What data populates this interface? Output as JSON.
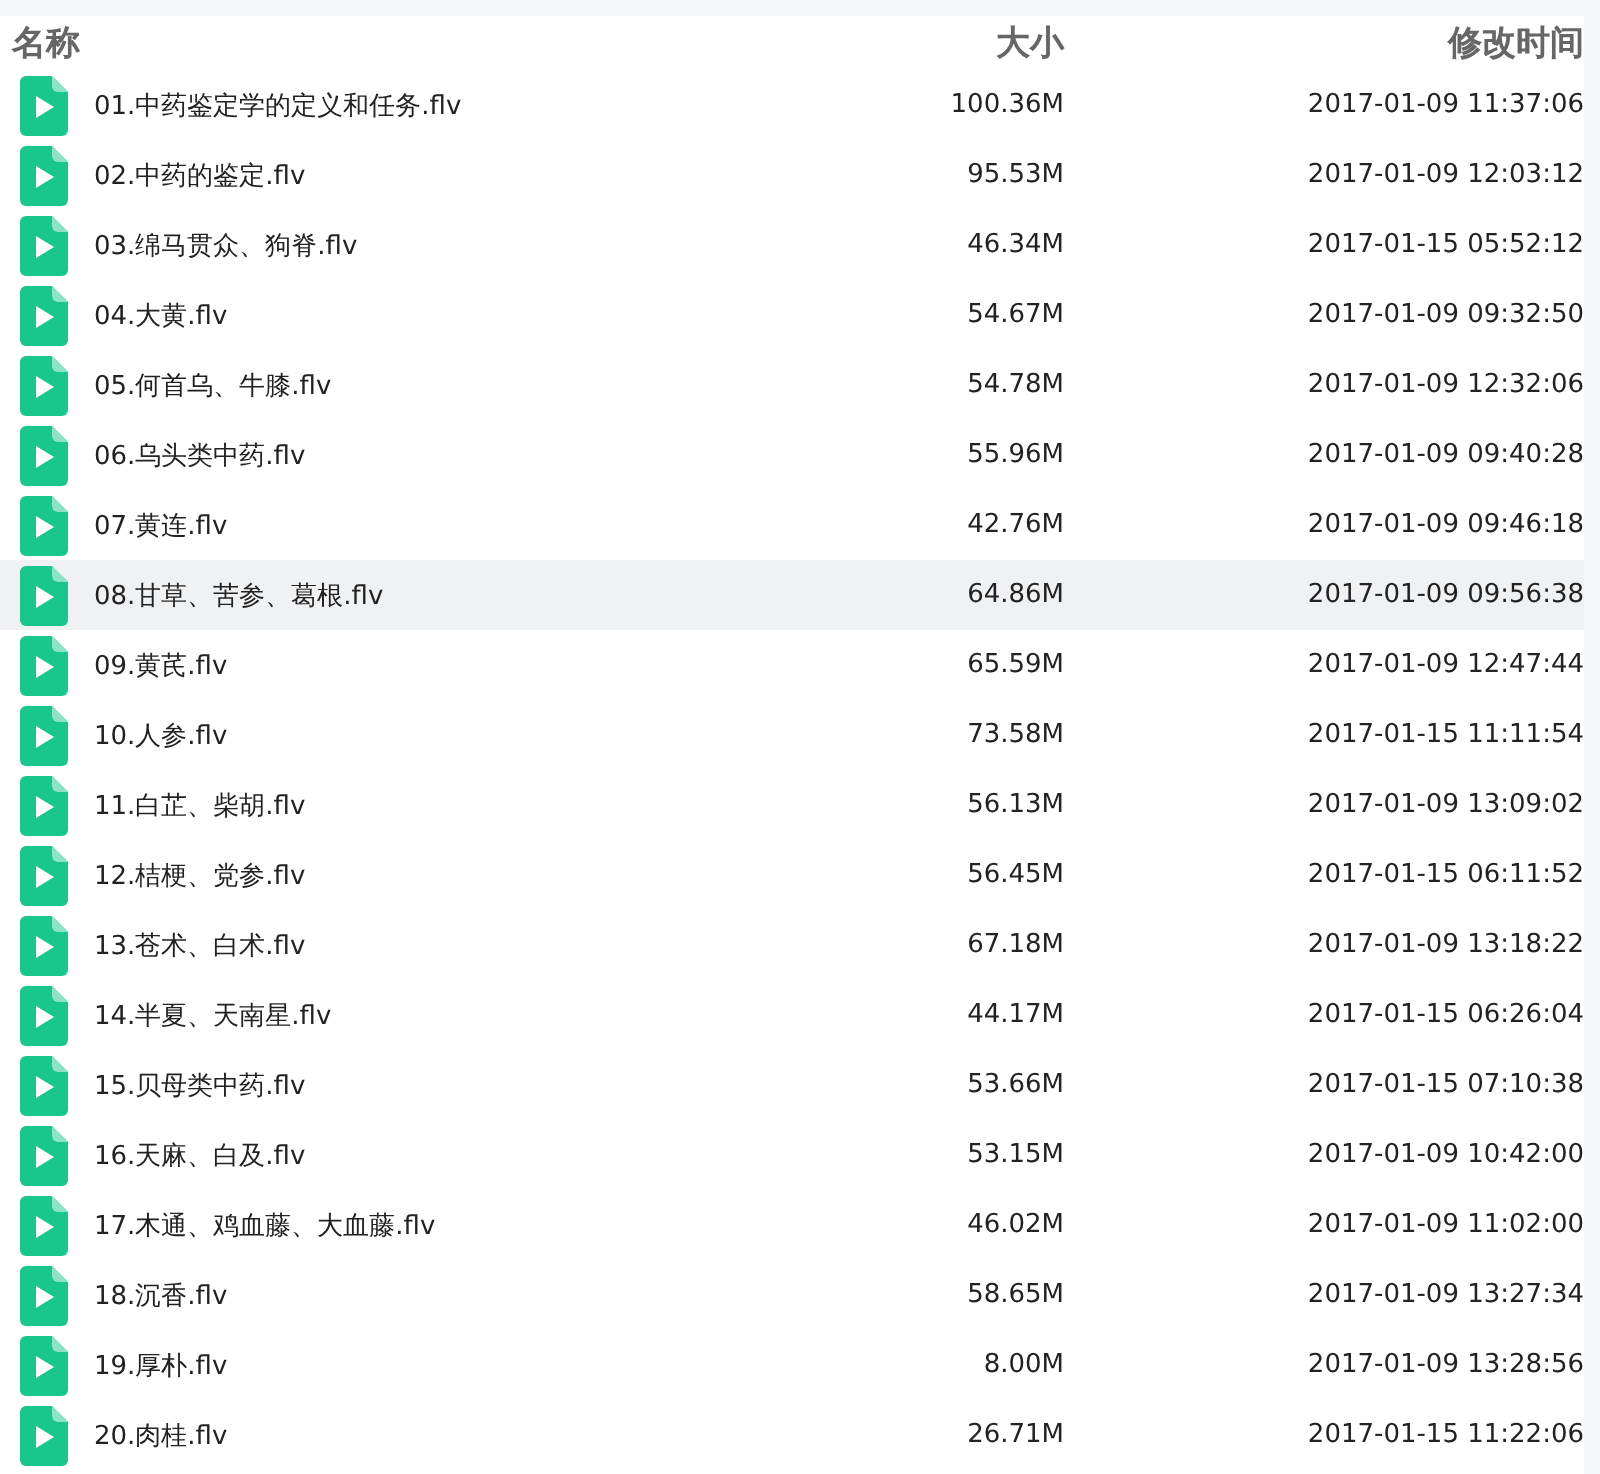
{
  "columns": [
    "名称",
    "大小",
    "修改时间"
  ],
  "rows": [
    {
      "name": "01.中药鉴定学的定义和任务.flv",
      "size": "100.36M",
      "modified": "2017-01-09 11:37:06",
      "selected": false
    },
    {
      "name": "02.中药的鉴定.flv",
      "size": "95.53M",
      "modified": "2017-01-09 12:03:12",
      "selected": false
    },
    {
      "name": "03.绵马贯众、狗脊.flv",
      "size": "46.34M",
      "modified": "2017-01-15 05:52:12",
      "selected": false
    },
    {
      "name": "04.大黄.flv",
      "size": "54.67M",
      "modified": "2017-01-09 09:32:50",
      "selected": false
    },
    {
      "name": "05.何首乌、牛膝.flv",
      "size": "54.78M",
      "modified": "2017-01-09 12:32:06",
      "selected": false
    },
    {
      "name": "06.乌头类中药.flv",
      "size": "55.96M",
      "modified": "2017-01-09 09:40:28",
      "selected": false
    },
    {
      "name": "07.黄连.flv",
      "size": "42.76M",
      "modified": "2017-01-09 09:46:18",
      "selected": false
    },
    {
      "name": "08.甘草、苦参、葛根.flv",
      "size": "64.86M",
      "modified": "2017-01-09 09:56:38",
      "selected": true
    },
    {
      "name": "09.黄芪.flv",
      "size": "65.59M",
      "modified": "2017-01-09 12:47:44",
      "selected": false
    },
    {
      "name": "10.人参.flv",
      "size": "73.58M",
      "modified": "2017-01-15 11:11:54",
      "selected": false
    },
    {
      "name": "11.白芷、柴胡.flv",
      "size": "56.13M",
      "modified": "2017-01-09 13:09:02",
      "selected": false
    },
    {
      "name": "12.桔梗、党参.flv",
      "size": "56.45M",
      "modified": "2017-01-15 06:11:52",
      "selected": false
    },
    {
      "name": "13.苍术、白术.flv",
      "size": "67.18M",
      "modified": "2017-01-09 13:18:22",
      "selected": false
    },
    {
      "name": "14.半夏、天南星.flv",
      "size": "44.17M",
      "modified": "2017-01-15 06:26:04",
      "selected": false
    },
    {
      "name": "15.贝母类中药.flv",
      "size": "53.66M",
      "modified": "2017-01-15 07:10:38",
      "selected": false
    },
    {
      "name": "16.天麻、白及.flv",
      "size": "53.15M",
      "modified": "2017-01-09 10:42:00",
      "selected": false
    },
    {
      "name": "17.木通、鸡血藤、大血藤.flv",
      "size": "46.02M",
      "modified": "2017-01-09 11:02:00",
      "selected": false
    },
    {
      "name": "18.沉香.flv",
      "size": "58.65M",
      "modified": "2017-01-09 13:27:34",
      "selected": false
    },
    {
      "name": "19.厚朴.flv",
      "size": "8.00M",
      "modified": "2017-01-09 13:28:56",
      "selected": false
    },
    {
      "name": "20.肉桂.flv",
      "size": "26.71M",
      "modified": "2017-01-15 11:22:06",
      "selected": false
    }
  ]
}
